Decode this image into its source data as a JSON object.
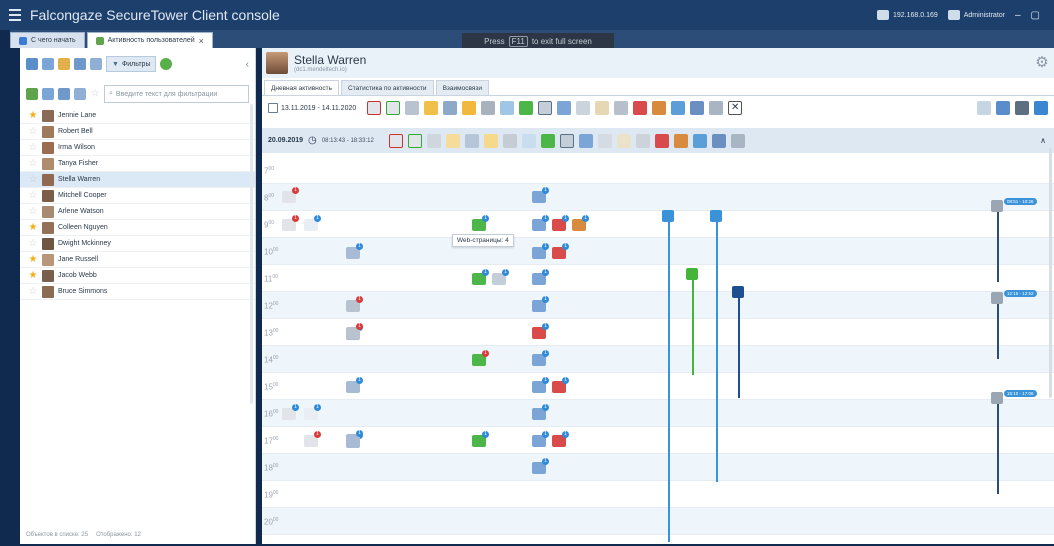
{
  "titlebar": {
    "app_title_brand": "Falcongaze SecureTower ",
    "app_title_bold": "Client console",
    "server_ip": "192.168.0.169",
    "user": "Administrator"
  },
  "window_tabs": [
    {
      "label": "С чего начать"
    },
    {
      "label": "Активность пользователей"
    }
  ],
  "fullscreen_toast": {
    "prefix": "Press",
    "key": "F11",
    "suffix": "to exit full screen"
  },
  "left_panel": {
    "filters_label": "Фильтры",
    "search_placeholder": "Введите текст для фильтрации",
    "users": [
      {
        "name": "Jennie Lane",
        "starred": true,
        "color": "#8a6a55"
      },
      {
        "name": "Robert Bell",
        "starred": false,
        "color": "#a07a5c"
      },
      {
        "name": "Irma Wilson",
        "starred": false,
        "color": "#9b6c50"
      },
      {
        "name": "Tanya Fisher",
        "starred": false,
        "color": "#b08c6e"
      },
      {
        "name": "Stella Warren",
        "starred": false,
        "color": "#8f6a50"
      },
      {
        "name": "Mitchell Cooper",
        "starred": false,
        "color": "#7c5d47"
      },
      {
        "name": "Arlene Watson",
        "starred": false,
        "color": "#a88a70"
      },
      {
        "name": "Colleen Nguyen",
        "starred": true,
        "color": "#94725a"
      },
      {
        "name": "Dwight Mckinney",
        "starred": false,
        "color": "#6f5643"
      },
      {
        "name": "Jane Russell",
        "starred": true,
        "color": "#b7967a"
      },
      {
        "name": "Jacob Webb",
        "starred": true,
        "color": "#7a604c"
      },
      {
        "name": "Bruce Simmons",
        "starred": false,
        "color": "#8b6b53"
      }
    ],
    "status_total": "Объектов в списке: 25",
    "status_shown": "Отображено: 12"
  },
  "right_panel": {
    "user_name": "Stella Warren",
    "user_sub": "(dc1.mendeltech.io)",
    "tabs": [
      {
        "label": "Дневная активность"
      },
      {
        "label": "Статистика по активности"
      },
      {
        "label": "Взаимосвязи"
      }
    ],
    "date_range": "13.11.2019 - 14.11.2020",
    "timeline": {
      "date": "20.09.2019",
      "times": "08:13:43 - 18:33:12",
      "hours": [
        "7",
        "8",
        "9",
        "10",
        "11",
        "12",
        "13",
        "14",
        "15",
        "16",
        "17",
        "18",
        "19",
        "20"
      ],
      "hour_suffix": "00",
      "tooltip": "Web-страницы: 4",
      "pill_1": "08:51 - 10:26",
      "pill_2": "12:15 - 12:52",
      "pill_3": "15:10 - 17:06"
    }
  },
  "colors": {
    "titlebar": "#1d3f6b",
    "accent_blue": "#3a93d9",
    "accent_green": "#44b53a",
    "accent_red": "#d93a3a",
    "selected_row": "#dbe8f5"
  }
}
